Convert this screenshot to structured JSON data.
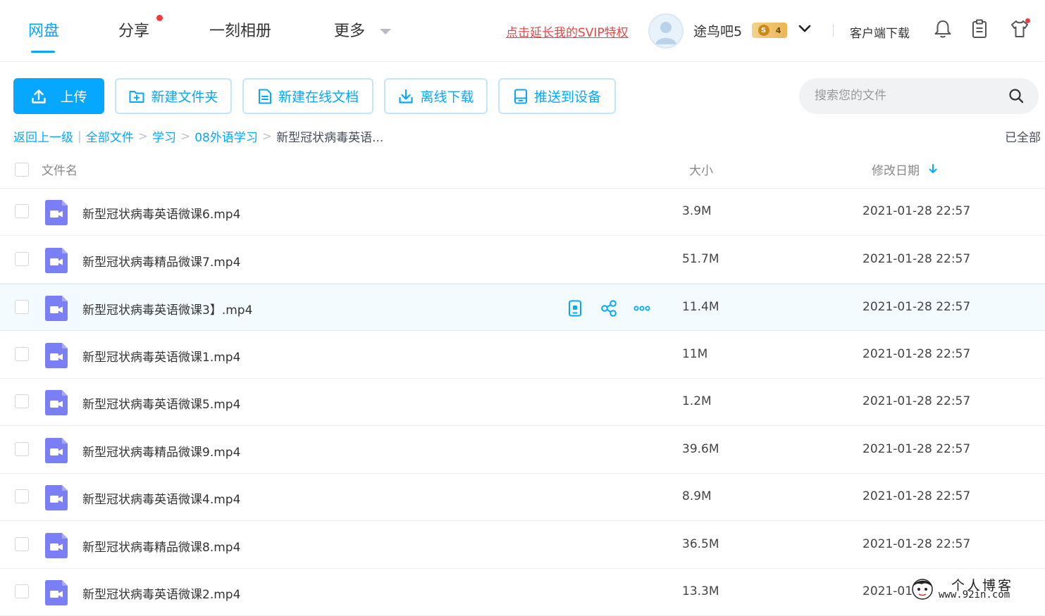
{
  "nav": {
    "tabs": [
      "网盘",
      "分享",
      "一刻相册",
      "更多"
    ],
    "svip_link": "点击延长我的SVIP特权",
    "username": "途鸟吧5",
    "vip_level": "4",
    "vip_letter": "S",
    "client_download": "客户端下载"
  },
  "toolbar": {
    "upload": "上传",
    "new_folder": "新建文件夹",
    "new_doc": "新建在线文档",
    "offline_download": "离线下载",
    "push_device": "推送到设备",
    "search_placeholder": "搜索您的文件"
  },
  "breadcrumb": {
    "back": "返回上一级",
    "all_files": "全部文件",
    "level1": "学习",
    "level2": "08外语学习",
    "current": "新型冠状病毒英语...",
    "status": "已全部"
  },
  "list": {
    "headers": {
      "name": "文件名",
      "size": "大小",
      "date": "修改日期"
    },
    "sort": "date-desc",
    "hover_row": 2,
    "rows": [
      {
        "name": "新型冠状病毒英语微课6.mp4",
        "size": "3.9M",
        "date": "2021-01-28 22:57"
      },
      {
        "name": "新型冠状病毒精品微课7.mp4",
        "size": "51.7M",
        "date": "2021-01-28 22:57"
      },
      {
        "name": "新型冠状病毒英语微课3】.mp4",
        "size": "11.4M",
        "date": "2021-01-28 22:57"
      },
      {
        "name": "新型冠状病毒英语微课1.mp4",
        "size": "11M",
        "date": "2021-01-28 22:57"
      },
      {
        "name": "新型冠状病毒英语微课5.mp4",
        "size": "1.2M",
        "date": "2021-01-28 22:57"
      },
      {
        "name": "新型冠状病毒精品微课9.mp4",
        "size": "39.6M",
        "date": "2021-01-28 22:57"
      },
      {
        "name": "新型冠状病毒英语微课4.mp4",
        "size": "8.9M",
        "date": "2021-01-28 22:57"
      },
      {
        "name": "新型冠状病毒精品微课8.mp4",
        "size": "36.5M",
        "date": "2021-01-28 22:57"
      },
      {
        "name": "新型冠状病毒英语微课2.mp4",
        "size": "13.3M",
        "date": "2021-01"
      }
    ]
  },
  "watermark": {
    "title": "个人博客",
    "url": "www.92in.com"
  },
  "colors": {
    "accent": "#06a7ff",
    "video_icon": "#7b7ff5",
    "alert": "#e84545"
  }
}
